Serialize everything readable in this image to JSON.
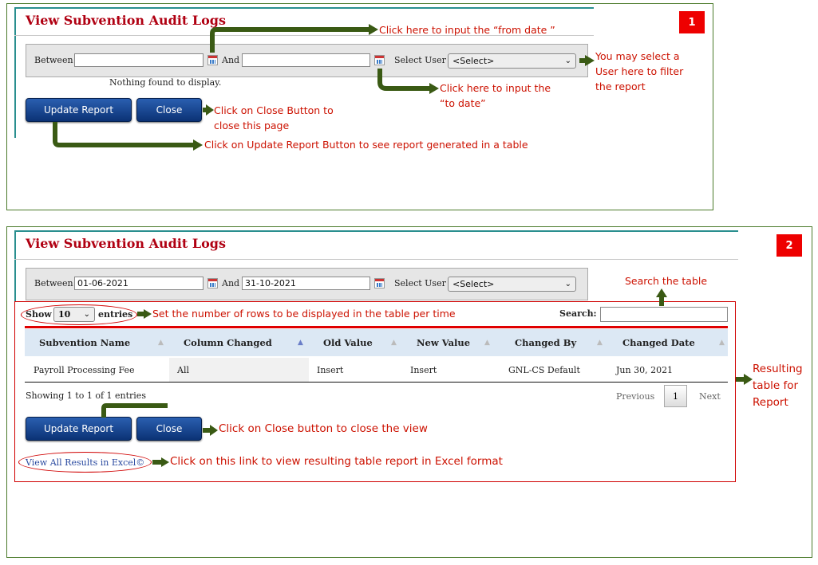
{
  "panel1": {
    "badge": "1",
    "title": "View Subvention Audit Logs",
    "between_label": "Between",
    "and_label": "And",
    "from_date_value": "",
    "to_date_value": "",
    "select_user_label": "Select User",
    "select_user_value": "<Select>",
    "nothing_found": "Nothing found to display.",
    "update_button": "Update Report",
    "close_button": "Close"
  },
  "panel2": {
    "badge": "2",
    "title": "View Subvention Audit Logs",
    "between_label": "Between",
    "and_label": "And",
    "from_date_value": "01-06-2021",
    "to_date_value": "31-10-2021",
    "select_user_label": "Select User",
    "select_user_value": "<Select>",
    "show_label": "Show",
    "entries_value": "10",
    "entries_label": "entries",
    "search_label": "Search:",
    "search_value": "",
    "columns": [
      "Subvention Name",
      "Column Changed",
      "Old Value",
      "New Value",
      "Changed By",
      "Changed Date"
    ],
    "rows": [
      [
        "Payroll Processing Fee",
        "All",
        "Insert",
        "Insert",
        "GNL-CS Default",
        "Jun 30, 2021"
      ]
    ],
    "showing_text": "Showing 1 to 1 of 1 entries",
    "pagination": {
      "previous": "Previous",
      "page": "1",
      "next": "Next"
    },
    "update_button": "Update Report",
    "close_button": "Close",
    "excel_link": "View All Results in Excel©"
  },
  "annotations": {
    "from_date": "Click here to input the “from date ”",
    "user_select": [
      "You may select a",
      "User here to filter",
      "the report"
    ],
    "to_date": [
      "Click here to input the",
      "“to date”"
    ],
    "close1": [
      "Click on Close Button to",
      "close this page"
    ],
    "update1": "Click on Update Report Button to see report generated in a table",
    "search_table": "Search the table",
    "rows_per_time": "Set the number of rows to be displayed in the table per time",
    "result_table": [
      "Resulting",
      "table for",
      "Report"
    ],
    "close2": "Click on Close button to close the view",
    "excel": "Click on this link to view resulting table report in Excel format"
  },
  "colors": {
    "title": "#b00012",
    "annotation": "#cc1100",
    "arrow": "#3a5a14",
    "button": "#0b3275",
    "badge": "#ee0000",
    "table_header": "#dce8f4",
    "link": "#2a4aa0"
  },
  "icons": {
    "calendar": "calendar-icon",
    "dropdown": "chevron-down-icon",
    "sort": "sort-icon",
    "arrow": "arrow-right-icon"
  }
}
